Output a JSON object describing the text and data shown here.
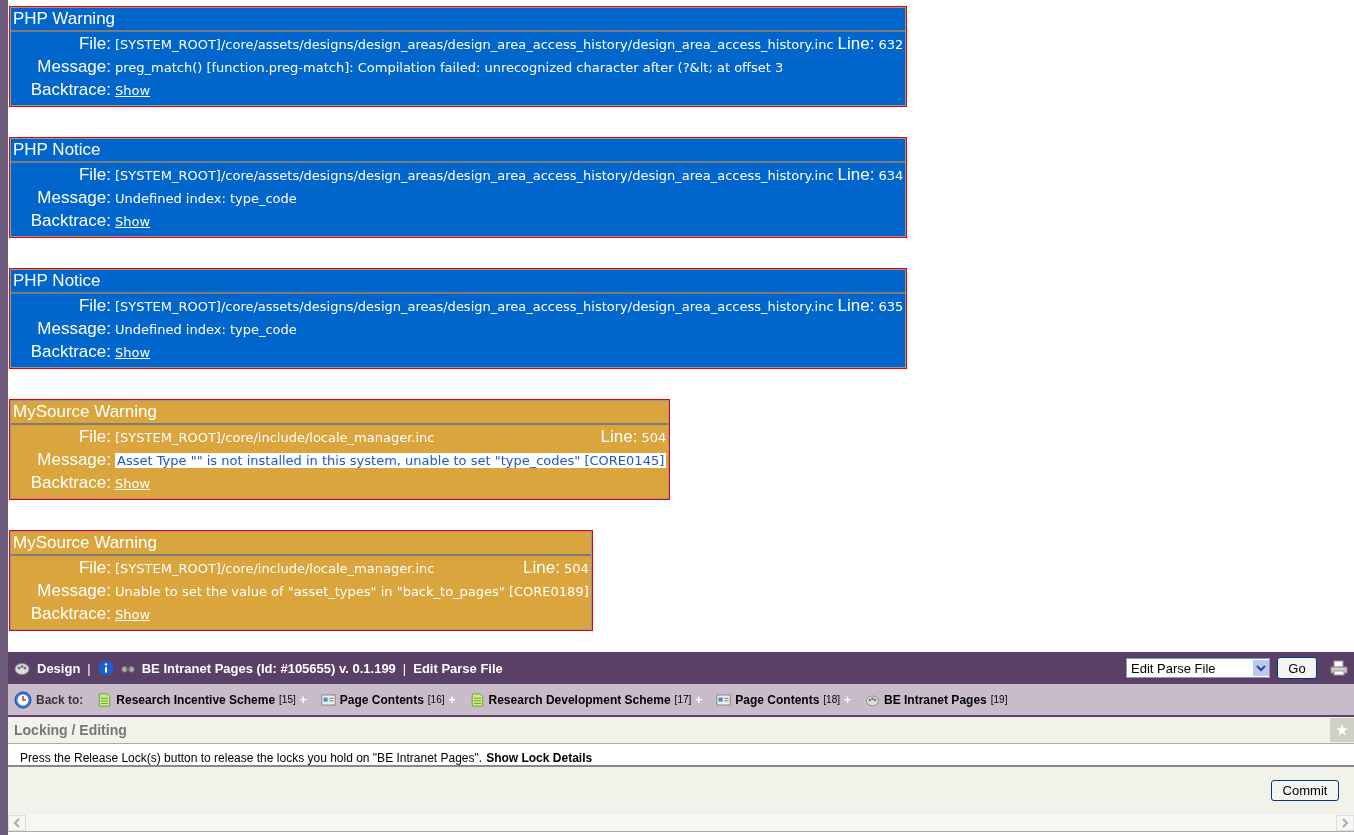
{
  "errors": [
    {
      "kind": "php",
      "title": "PHP Warning",
      "file_label": "File:",
      "file": "[SYSTEM_ROOT]/core/assets/designs/design_areas/design_area_access_history/design_area_access_history.inc",
      "line_label": "Line:",
      "line": "632",
      "message_label": "Message:",
      "message": "preg_match() [function.preg-match]: Compilation failed: unrecognized character after (?&lt; at offset 3",
      "message_selected": false,
      "backtrace_label": "Backtrace:",
      "backtrace_link": "Show"
    },
    {
      "kind": "php",
      "title": "PHP Notice",
      "file_label": "File:",
      "file": "[SYSTEM_ROOT]/core/assets/designs/design_areas/design_area_access_history/design_area_access_history.inc",
      "line_label": "Line:",
      "line": "634",
      "message_label": "Message:",
      "message": "Undefined index: type_code",
      "message_selected": false,
      "backtrace_label": "Backtrace:",
      "backtrace_link": "Show"
    },
    {
      "kind": "php",
      "title": "PHP Notice",
      "file_label": "File:",
      "file": "[SYSTEM_ROOT]/core/assets/designs/design_areas/design_area_access_history/design_area_access_history.inc",
      "line_label": "Line:",
      "line": "635",
      "message_label": "Message:",
      "message": "Undefined index: type_code",
      "message_selected": false,
      "backtrace_label": "Backtrace:",
      "backtrace_link": "Show"
    },
    {
      "kind": "mysource",
      "title": "MySource Warning",
      "file_label": "File:",
      "file": "[SYSTEM_ROOT]/core/include/locale_manager.inc",
      "line_label": "Line:",
      "line": "504",
      "message_label": "Message:",
      "message": "Asset Type \"\" is not installed in this system, unable to set \"type_codes\" [CORE0145]",
      "message_selected": true,
      "backtrace_label": "Backtrace:",
      "backtrace_link": "Show"
    },
    {
      "kind": "mysource",
      "title": "MySource Warning",
      "file_label": "File:",
      "file": "[SYSTEM_ROOT]/core/include/locale_manager.inc",
      "line_label": "Line:",
      "line": "504",
      "message_label": "Message:",
      "message": "Unable to set the value of \"asset_types\" in \"back_to_pages\" [CORE0189]",
      "message_selected": false,
      "backtrace_label": "Backtrace:",
      "backtrace_link": "Show"
    }
  ],
  "toolbar": {
    "design_link": "Design",
    "separator_1": "|",
    "asset_title": "BE Intranet Pages (Id: #105655) v. 0.1.199",
    "separator_2": "|",
    "screen_name": "Edit Parse File",
    "screen_select": "Edit Parse File",
    "go_button": "Go"
  },
  "breadcrumbs": {
    "label": "Back to:",
    "items": [
      {
        "kind": "page",
        "name": "Research Incentive Scheme",
        "count": "[15]",
        "plus": "+"
      },
      {
        "kind": "contents",
        "name": "Page Contents",
        "count": "[16]",
        "plus": "+"
      },
      {
        "kind": "page",
        "name": "Research Development Scheme",
        "count": "[17]",
        "plus": "+"
      },
      {
        "kind": "contents",
        "name": "Page Contents",
        "count": "[18]",
        "plus": "+"
      },
      {
        "kind": "site",
        "name": "BE Intranet Pages",
        "count": "[19]"
      }
    ]
  },
  "section": {
    "title": "Locking / Editing",
    "text": "Press the Release Lock(s) button to release the locks you hold on \"BE Intranet Pages\".",
    "link": "Show Lock Details"
  },
  "commit_button": "Commit"
}
